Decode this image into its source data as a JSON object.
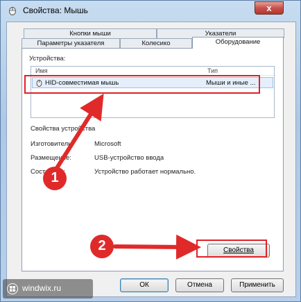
{
  "window": {
    "title": "Свойства: Мышь",
    "close_glyph": "x"
  },
  "tabs": {
    "row1": [
      "Кнопки мыши",
      "Указатели"
    ],
    "row2": [
      "Параметры указателя",
      "Колесико",
      "Оборудование"
    ],
    "active": "Оборудование"
  },
  "devices": {
    "label": "Устройства:",
    "columns": {
      "name": "Имя",
      "type": "Тип"
    },
    "rows": [
      {
        "name": "HID-совместимая мышь",
        "type": "Мыши и иные ..."
      }
    ]
  },
  "device_properties": {
    "title": "Свойства устройства",
    "fields": [
      {
        "label": "Изготовитель:",
        "value": "Microsoft"
      },
      {
        "label": "Размещение:",
        "value": "USB-устройство ввода"
      },
      {
        "label": "Состояние:",
        "value": "Устройство работает нормально."
      }
    ]
  },
  "buttons": {
    "properties": "Свойства",
    "ok": "ОК",
    "cancel": "Отмена",
    "apply": "Применить"
  },
  "annotations": {
    "badge1": "1",
    "badge2": "2",
    "accent": "#e02025"
  },
  "watermark": {
    "text": "windwix.ru"
  }
}
